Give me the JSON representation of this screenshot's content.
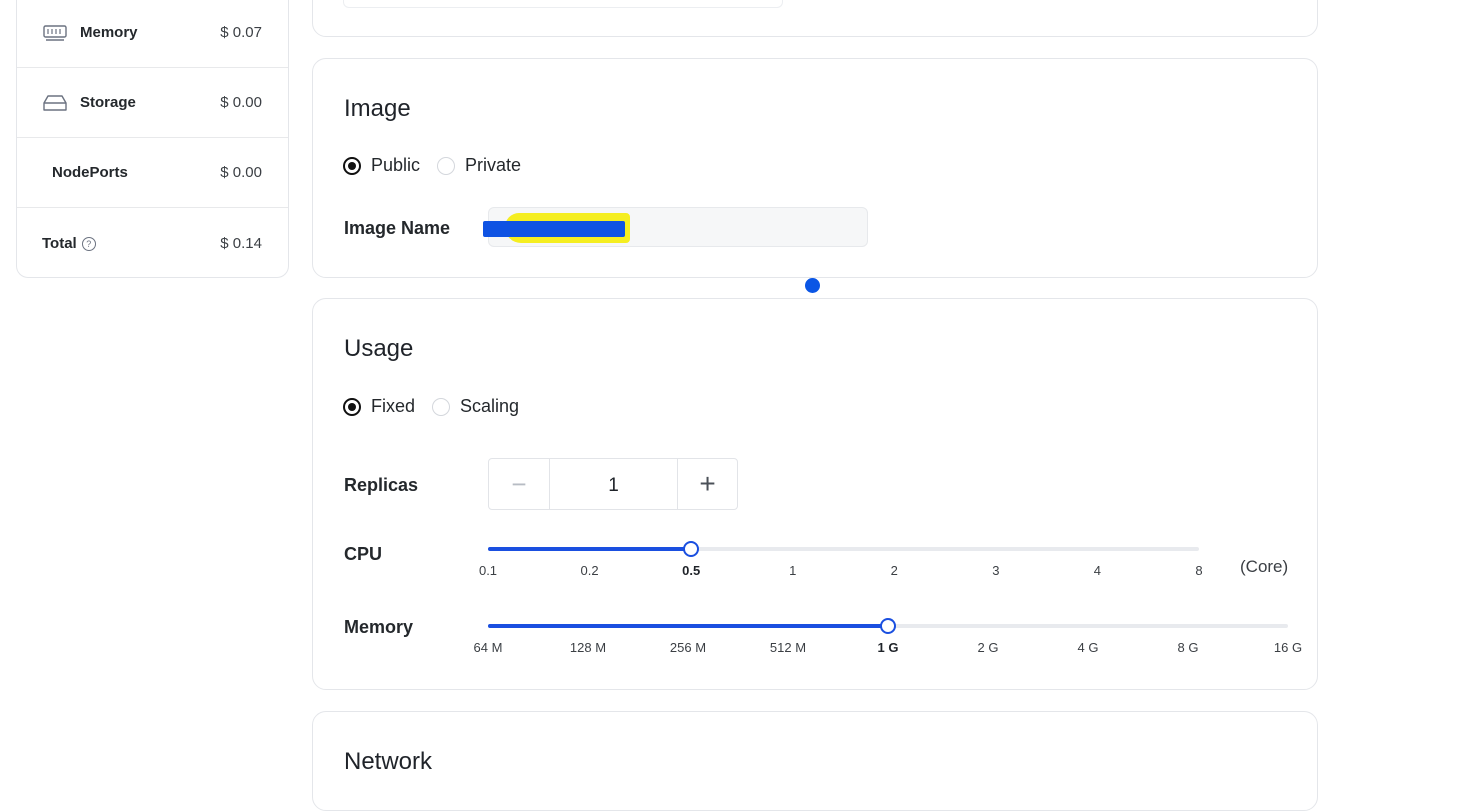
{
  "cost_summary": {
    "rows": [
      {
        "label": "Memory",
        "price": "$ 0.07",
        "icon": "memory-icon"
      },
      {
        "label": "Storage",
        "price": "$ 0.00",
        "icon": "storage-icon"
      },
      {
        "label": "NodePorts",
        "price": "$ 0.00",
        "icon": ""
      },
      {
        "label": "Total",
        "price": "$ 0.14",
        "icon": "help-icon"
      }
    ],
    "help_glyph": "?"
  },
  "image_section": {
    "title": "Image",
    "options": [
      {
        "label": "Public",
        "checked": true
      },
      {
        "label": "Private",
        "checked": false
      }
    ],
    "image_name_label": "Image Name",
    "image_name_value": ""
  },
  "usage_section": {
    "title": "Usage",
    "options": [
      {
        "label": "Fixed",
        "checked": true
      },
      {
        "label": "Scaling",
        "checked": false
      }
    ],
    "replicas_label": "Replicas",
    "replicas_value": "1",
    "minus_glyph": "−",
    "plus_glyph": "+",
    "cpu": {
      "label": "CPU",
      "ticks": [
        "0.1",
        "0.2",
        "0.5",
        "1",
        "2",
        "3",
        "4",
        "8"
      ],
      "selected": "0.5",
      "unit": "(Core)"
    },
    "memory": {
      "label": "Memory",
      "ticks": [
        "64 M",
        "128 M",
        "256 M",
        "512 M",
        "1 G",
        "2 G",
        "4 G",
        "8 G",
        "16 G"
      ],
      "selected": "1 G"
    }
  },
  "network_section": {
    "title": "Network"
  },
  "colors": {
    "accent": "#1a4fe0",
    "redaction_blue": "#0f53e3",
    "redaction_yellow": "#f5ee21"
  }
}
